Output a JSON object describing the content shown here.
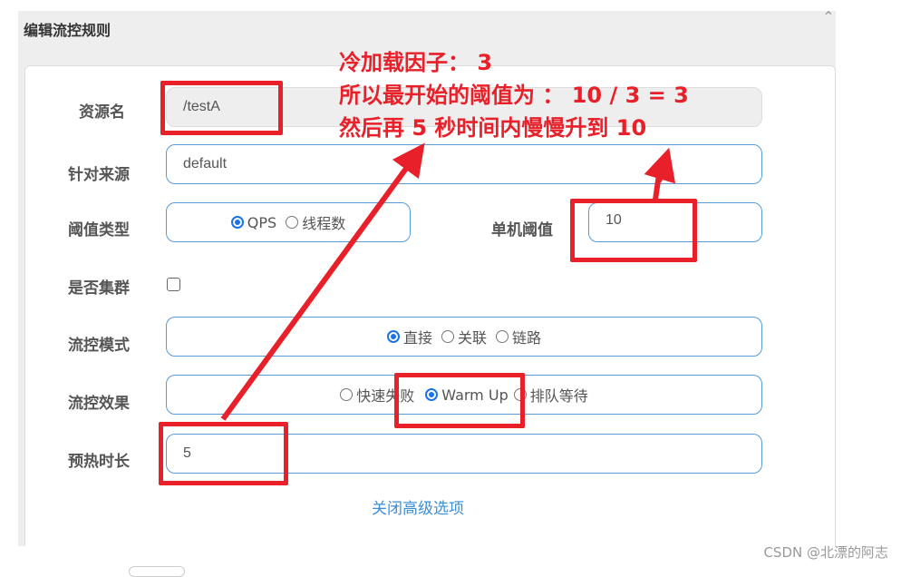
{
  "dialog": {
    "title": "编辑流控规则",
    "collapse_icon": "chevron-up-icon"
  },
  "form": {
    "resource_name": {
      "label": "资源名",
      "value": "/testA"
    },
    "limit_app": {
      "label": "针对来源",
      "value": "default"
    },
    "threshold_type": {
      "label": "阈值类型",
      "options": [
        {
          "label": "QPS",
          "checked": true
        },
        {
          "label": "线程数",
          "checked": false
        }
      ]
    },
    "single_threshold": {
      "label": "单机阈值",
      "value": "10"
    },
    "cluster_mode": {
      "label": "是否集群",
      "checked": false
    },
    "control_mode": {
      "label": "流控模式",
      "options": [
        {
          "label": "直接",
          "checked": true
        },
        {
          "label": "关联",
          "checked": false
        },
        {
          "label": "链路",
          "checked": false
        }
      ]
    },
    "control_effect": {
      "label": "流控效果",
      "options": [
        {
          "label": "快速失败",
          "checked": false
        },
        {
          "label": "Warm Up",
          "checked": true
        },
        {
          "label": "排队等待",
          "checked": false
        }
      ]
    },
    "warmup_period": {
      "label": "预热时长",
      "value": "5"
    },
    "toggle_advanced_link": "关闭高级选项"
  },
  "annotation": {
    "color": "#e8202a",
    "lines": [
      "冷加载因子： 3",
      "所以最开始的阈值为 ： 10 / 3 = 3",
      "然后再 5 秒时间内慢慢升到 10"
    ]
  },
  "watermark": "CSDN @北漂的阿志"
}
